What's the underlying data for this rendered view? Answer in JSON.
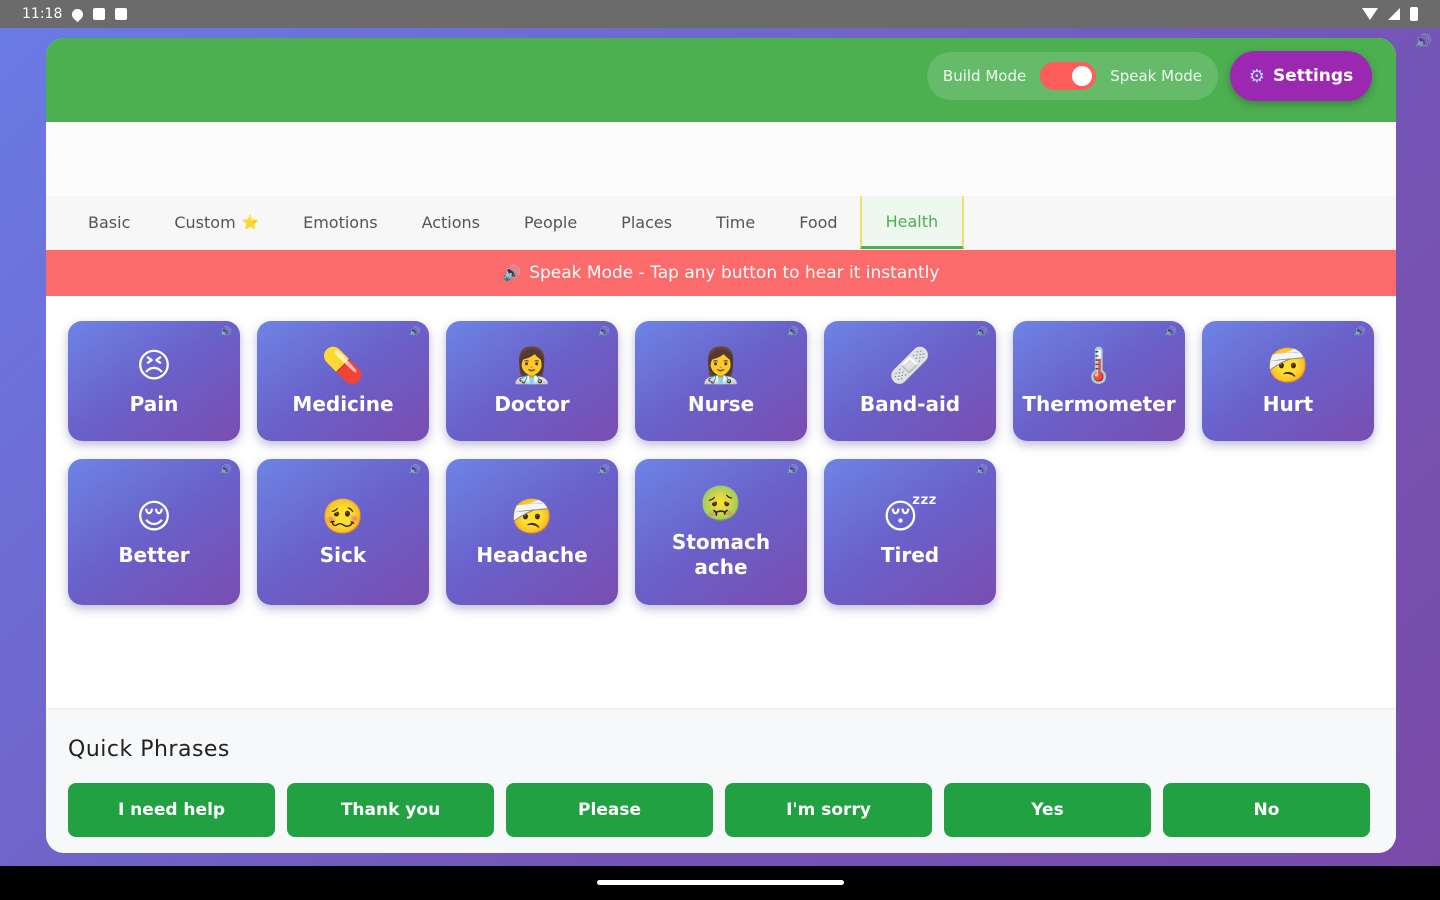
{
  "status_bar": {
    "time": "11:18"
  },
  "header": {
    "build_mode_label": "Build Mode",
    "speak_mode_label": "Speak Mode",
    "settings_label": "Settings"
  },
  "tabs": [
    {
      "label": "Basic"
    },
    {
      "label": "Custom"
    },
    {
      "label": "Emotions"
    },
    {
      "label": "Actions"
    },
    {
      "label": "People"
    },
    {
      "label": "Places"
    },
    {
      "label": "Time"
    },
    {
      "label": "Food"
    },
    {
      "label": "Health",
      "active": true
    }
  ],
  "banner": {
    "text": "Speak Mode - Tap any button to hear it instantly"
  },
  "tiles": [
    {
      "emoji": "😣",
      "label": "Pain"
    },
    {
      "emoji": "💊",
      "label": "Medicine"
    },
    {
      "emoji": "👩‍⚕️",
      "label": "Doctor"
    },
    {
      "emoji": "👩‍⚕️",
      "label": "Nurse"
    },
    {
      "emoji": "🩹",
      "label": "Band-aid"
    },
    {
      "emoji": "🌡️",
      "label": "Thermometer"
    },
    {
      "emoji": "🤕",
      "label": "Hurt"
    },
    {
      "emoji": "😌",
      "label": "Better"
    },
    {
      "emoji": "🥴",
      "label": "Sick"
    },
    {
      "emoji": "🤕",
      "label": "Headache"
    },
    {
      "emoji": "🤢",
      "label": "Stomach ache"
    },
    {
      "emoji": "😴",
      "label": "Tired"
    }
  ],
  "quick_phrases": {
    "title": "Quick Phrases",
    "items": [
      "I need help",
      "Thank you",
      "Please",
      "I'm sorry",
      "Yes",
      "No"
    ]
  },
  "colors": {
    "header_green": "#4caf50",
    "settings_purple": "#9c27b0",
    "banner_red": "#fb6b6b",
    "phrase_green": "#22a143",
    "toggle_red": "#ff5c5c"
  }
}
